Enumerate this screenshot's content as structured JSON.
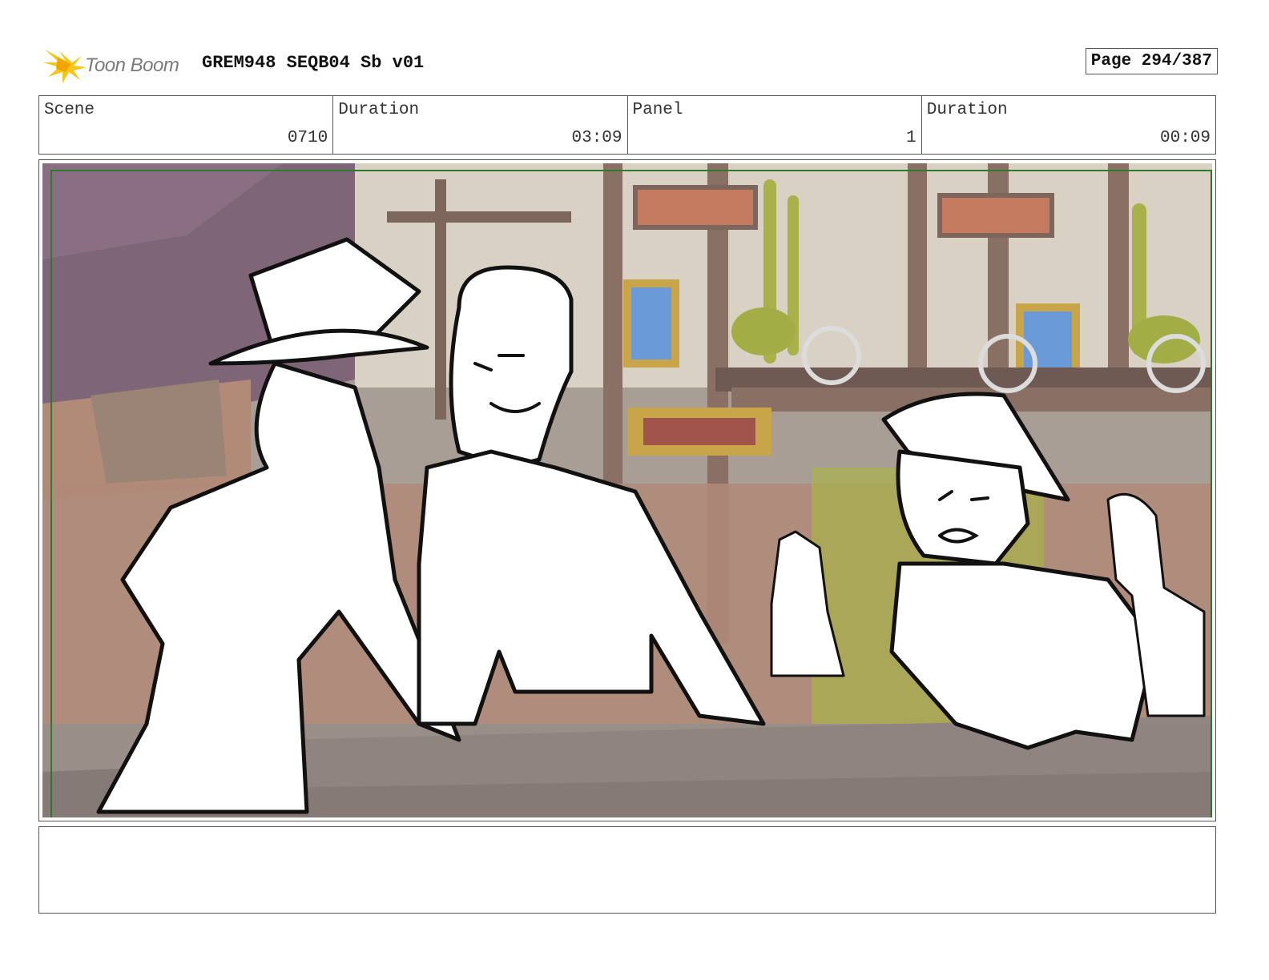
{
  "header": {
    "logo_text": "Toon Boom",
    "title": "GREM948 SEQB04 Sb v01",
    "page": "Page 294/387"
  },
  "info": {
    "scene_label": "Scene",
    "scene_value": "0710",
    "scene_duration_label": "Duration",
    "scene_duration_value": "03:09",
    "panel_label": "Panel",
    "panel_value": "1",
    "panel_duration_label": "Duration",
    "panel_duration_value": "00:09"
  },
  "colors": {
    "safe_frame": "#2d7a2d",
    "logo_burst": "#f5c518"
  },
  "notes": {
    "text": ""
  }
}
